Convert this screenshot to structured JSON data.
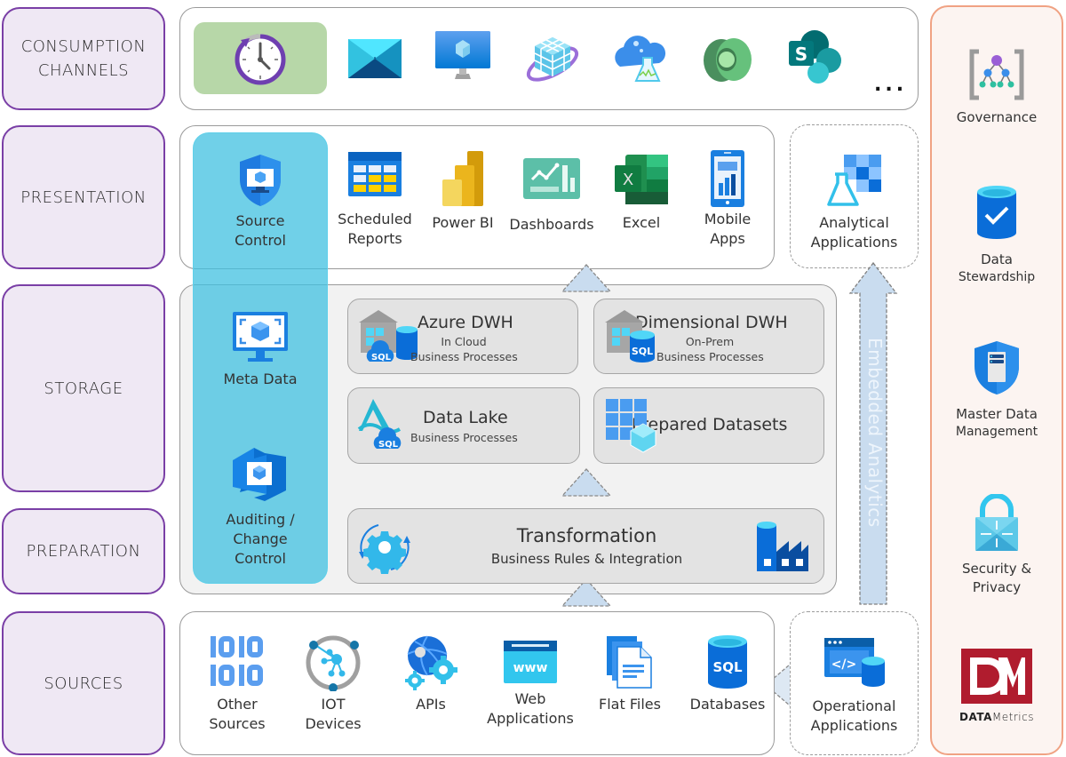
{
  "layers": {
    "consumption": "CONSUMPTION\nCHANNELS",
    "consumption_line1": "CONSUMPTION",
    "consumption_line2": "CHANNELS",
    "presentation": "PRESENTATION",
    "storage": "STORAGE",
    "preparation": "PREPARATION",
    "sources": "SOURCES"
  },
  "consumption_channels": {
    "icons": [
      "scheduled-clock-icon",
      "email-icon",
      "virtual-machine-icon",
      "analysis-cube-icon",
      "machine-learning-cloud-icon",
      "dynamics-365-icon",
      "sharepoint-icon"
    ],
    "more": "..."
  },
  "presentation": {
    "items": [
      {
        "line1": "Scheduled",
        "line2": "Reports",
        "icon": "calendar-grid-icon"
      },
      {
        "line1": "Power BI",
        "line2": "",
        "icon": "power-bi-icon"
      },
      {
        "line1": "Dashboards",
        "line2": "",
        "icon": "dashboard-chart-icon"
      },
      {
        "line1": "Excel",
        "line2": "",
        "icon": "excel-icon"
      },
      {
        "line1": "Mobile",
        "line2": "Apps",
        "icon": "mobile-app-icon"
      }
    ],
    "analytical": {
      "line1": "Analytical",
      "line2": "Applications",
      "icon": "analytics-flask-icon"
    }
  },
  "cross_cutting": {
    "source_control": {
      "line1": "Source",
      "line2": "Control"
    },
    "meta_data": {
      "line1": "Meta Data"
    },
    "auditing": {
      "line1": "Auditing /",
      "line2": "Change",
      "line3": "Control"
    }
  },
  "storage": {
    "azure_dwh": {
      "title": "Azure DWH",
      "sub1": "In Cloud",
      "sub2": "Business Processes"
    },
    "dimensional_dwh": {
      "title": "Dimensional DWH",
      "sub1": "On-Prem",
      "sub2": "Business Processes"
    },
    "data_lake": {
      "title": "Data Lake",
      "sub1": "Business Processes"
    },
    "prepared": {
      "title": "Prepared Datasets"
    }
  },
  "preparation": {
    "title": "Transformation",
    "subtitle": "Business Rules & Integration"
  },
  "embedded": "Embedded Analytics",
  "sources": {
    "items": [
      {
        "line1": "Other",
        "line2": "Sources",
        "icon": "binary-icon"
      },
      {
        "line1": "IOT",
        "line2": "Devices",
        "icon": "iot-hub-icon"
      },
      {
        "line1": "APIs",
        "line2": "",
        "icon": "api-globe-gears-icon"
      },
      {
        "line1": "Web",
        "line2": "Applications",
        "icon": "web-www-icon"
      },
      {
        "line1": "Flat Files",
        "line2": "",
        "icon": "flat-files-icon"
      },
      {
        "line1": "Databases",
        "line2": "",
        "icon": "sql-database-icon"
      }
    ],
    "operational": {
      "line1": "Operational",
      "line2": "Applications"
    }
  },
  "governance": {
    "items": [
      {
        "line1": "Governance",
        "line2": ""
      },
      {
        "line1": "Data",
        "line2": "Stewardship"
      },
      {
        "line1": "Master Data",
        "line2": "Management"
      },
      {
        "line1": "Security &",
        "line2": "Privacy"
      }
    ],
    "brand_bold": "DATA",
    "brand_light": "Metrics"
  },
  "colors": {
    "layer_border": "#7a3fa6",
    "layer_fill": "#efe8f4",
    "side_band": "#40c0e0",
    "gov_border": "#f0a283",
    "gov_fill": "#fcf4f1",
    "arrow_fill": "#c9dcef",
    "brand_red": "#b01c2e"
  }
}
